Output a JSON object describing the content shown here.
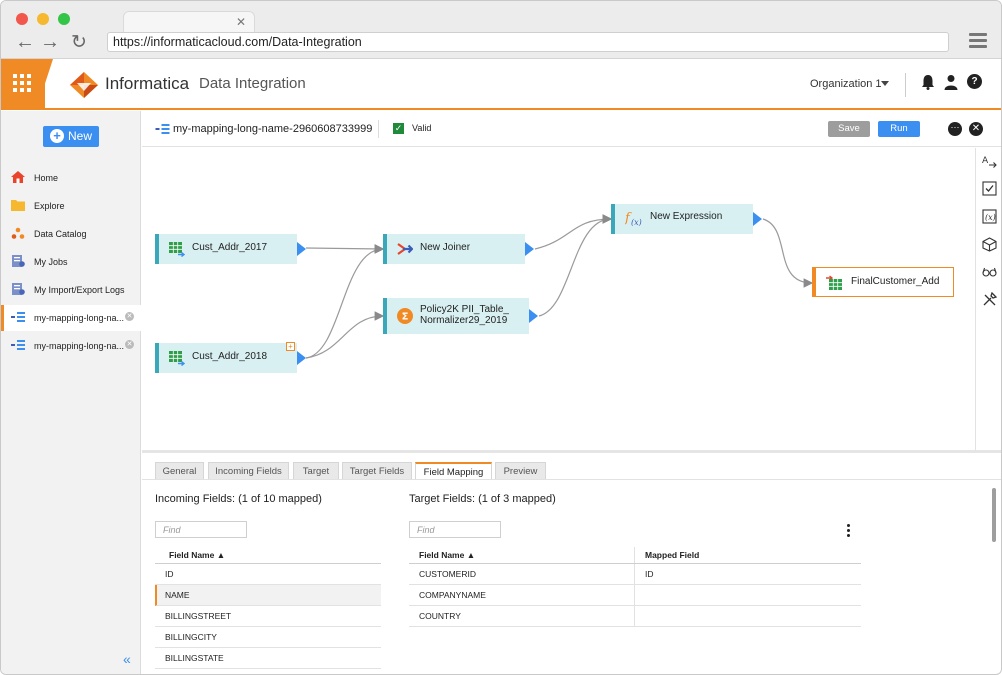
{
  "browser": {
    "url": "https://informaticacloud.com/Data-Integration",
    "traffic_colors": [
      "#f2574c",
      "#f5b82e",
      "#33c548"
    ]
  },
  "header": {
    "brand": "Informatica",
    "product": "Data Integration",
    "organization": "Organization 1",
    "accent": "#f08a24"
  },
  "sidebar": {
    "new_label": "New",
    "items": [
      {
        "label": "Home",
        "icon": "home-icon"
      },
      {
        "label": "Explore",
        "icon": "folder-icon"
      },
      {
        "label": "Data Catalog",
        "icon": "catalog-icon"
      },
      {
        "label": "My Jobs",
        "icon": "jobs-icon"
      },
      {
        "label": "My Import/Export Logs",
        "icon": "logs-icon"
      },
      {
        "label": "my-mapping-long-na...",
        "icon": "mapping-icon"
      },
      {
        "label": "my-mapping-long-na...",
        "icon": "mapping-icon"
      }
    ]
  },
  "toolbar": {
    "mapping_name": "my-mapping-long-name-2960608733999",
    "valid_label": "Valid",
    "save_label": "Save",
    "run_label": "Run"
  },
  "canvas": {
    "nodes": [
      {
        "label": "Cust_Addr_2017",
        "type": "source"
      },
      {
        "label": "Cust_Addr_2018",
        "type": "source"
      },
      {
        "label": "New Joiner",
        "type": "joiner"
      },
      {
        "label": "Policy2K PII_Table_",
        "label2": "Normalizer29_2019",
        "type": "normalizer"
      },
      {
        "label": "New Expression",
        "type": "expression"
      },
      {
        "label": "FinalCustomer_Add",
        "type": "target"
      }
    ]
  },
  "panel": {
    "tabs": [
      "General",
      "Incoming Fields",
      "Target",
      "Target Fields",
      "Field Mapping",
      "Preview"
    ],
    "active_tab": "Field Mapping",
    "incoming": {
      "title": "Incoming Fields: (1 of 10 mapped)",
      "find_placeholder": "Find",
      "header": "Field Name",
      "rows": [
        "ID",
        "NAME",
        "BILLINGSTREET",
        "BILLINGCITY",
        "BILLINGSTATE"
      ],
      "selected_row": "NAME"
    },
    "target": {
      "title": "Target Fields: (1 of 3 mapped)",
      "find_placeholder": "Find",
      "header_field": "Field Name",
      "header_mapped": "Mapped Field",
      "rows": [
        {
          "field": "CUSTOMERID",
          "mapped": "ID"
        },
        {
          "field": "COMPANYNAME",
          "mapped": ""
        },
        {
          "field": "COUNTRY",
          "mapped": ""
        }
      ]
    }
  }
}
